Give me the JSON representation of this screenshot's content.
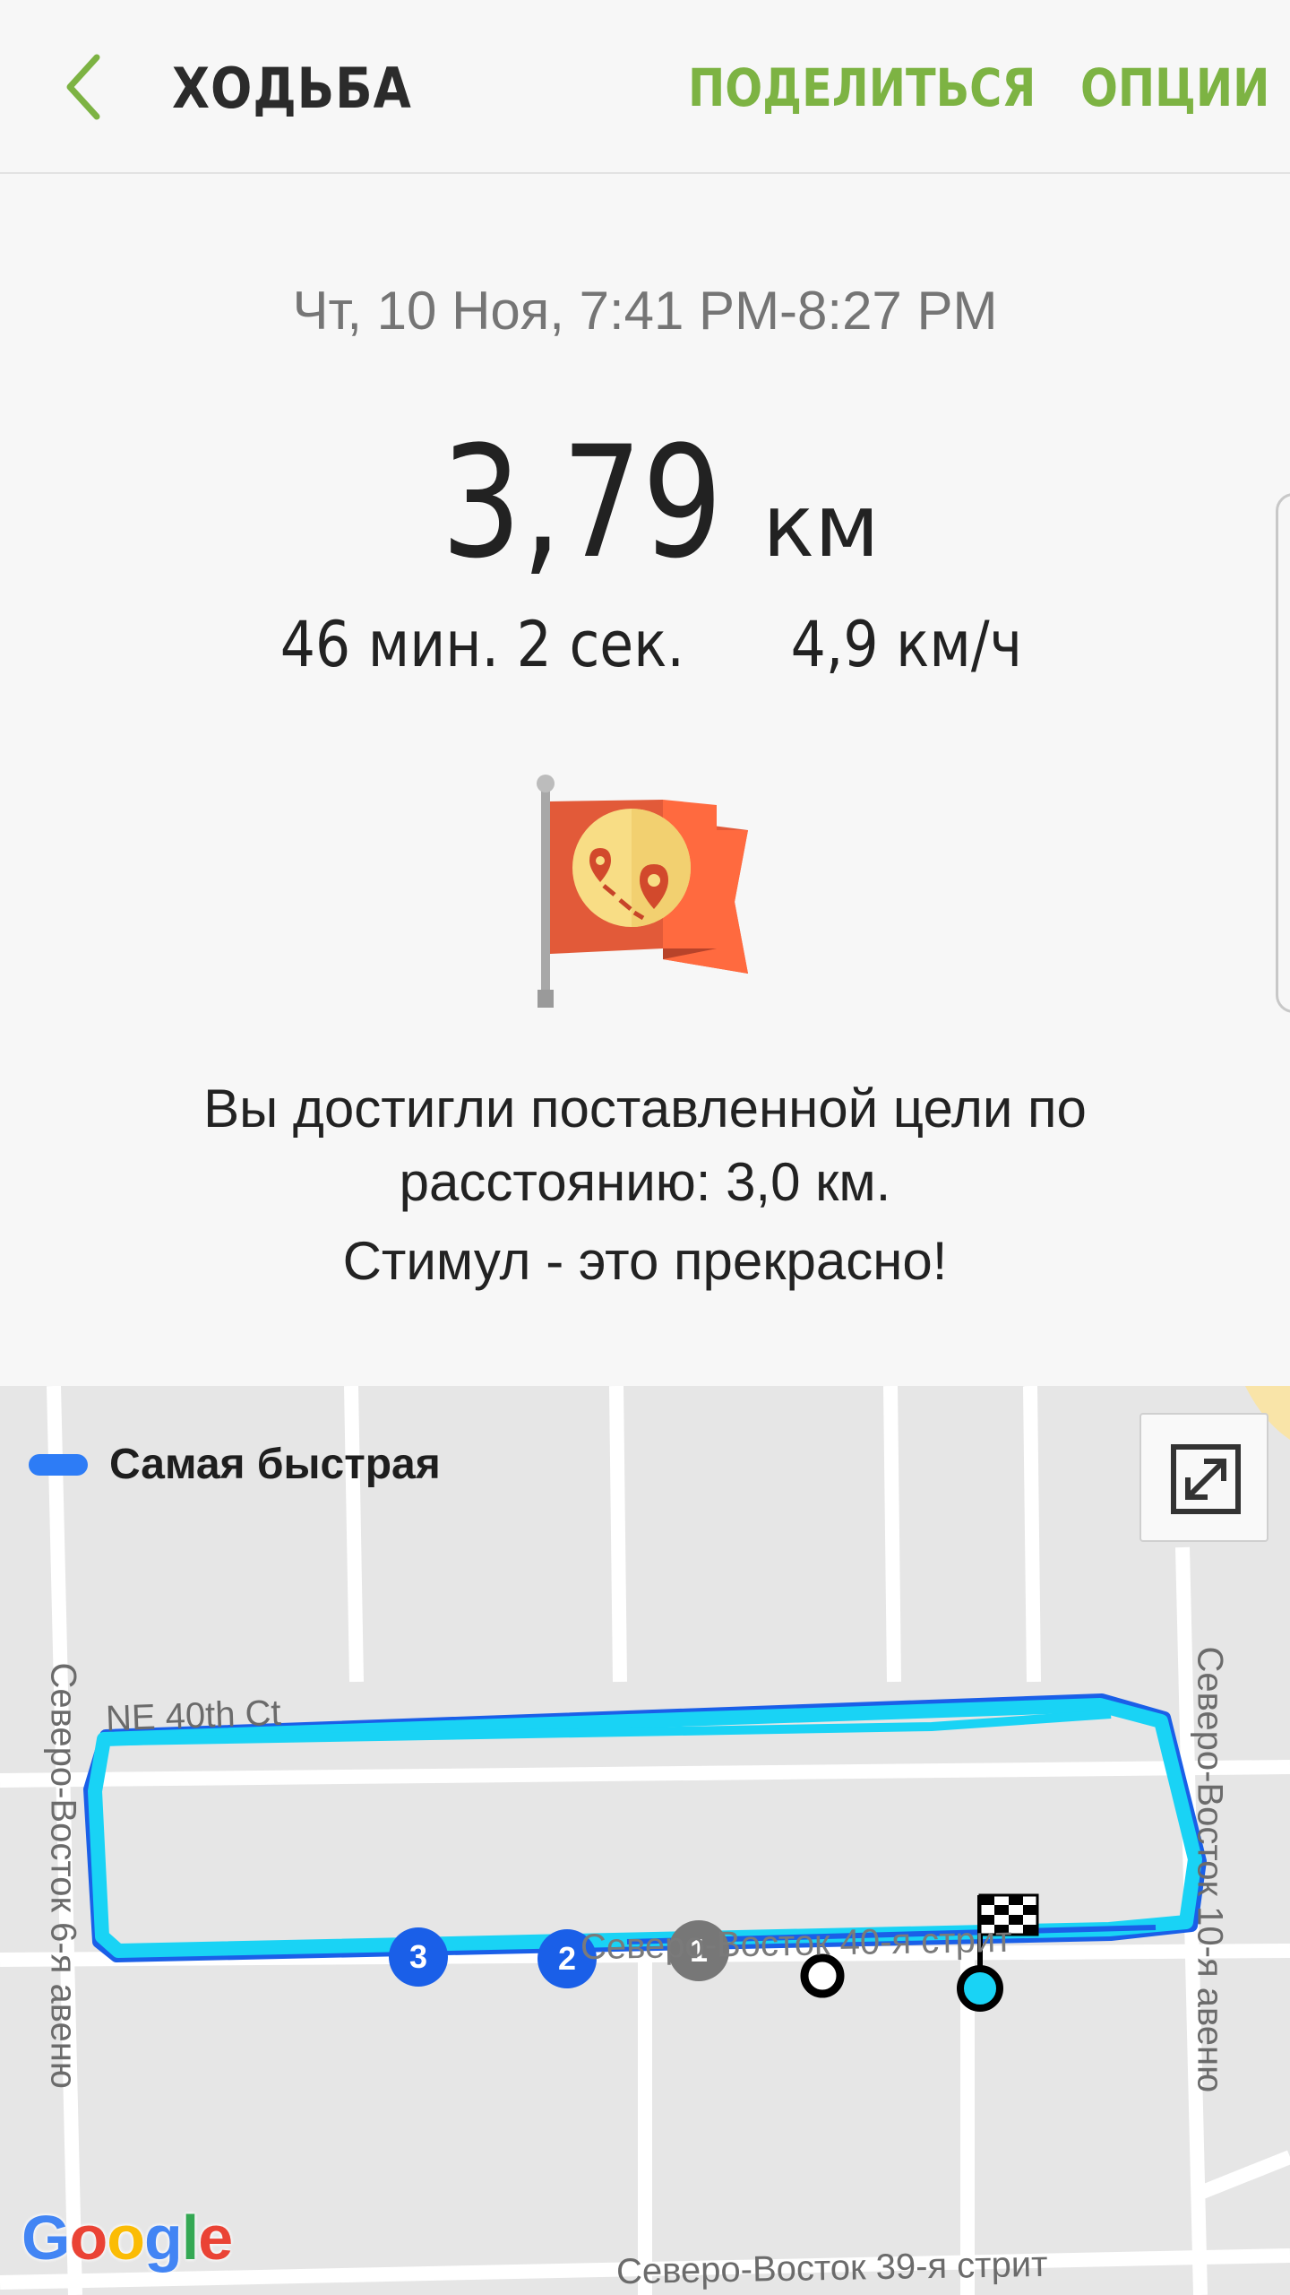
{
  "header": {
    "title": "ХОДЬБА",
    "share_label": "ПОДЕЛИТЬСЯ",
    "options_label": "ОПЦИИ"
  },
  "summary": {
    "date_range": "Чт, 10 Ноя, 7:41 PM-8:27 PM",
    "distance_value": "3,79",
    "distance_unit": "км",
    "duration": "46 мин. 2 сек.",
    "speed": "4,9 км/ч"
  },
  "goal": {
    "line1": "Вы достигли поставленной цели по",
    "line2": "расстоянию: 3,0 км.",
    "line3": "Стимул - это прекрасно!"
  },
  "map": {
    "legend_label": "Самая быстрая",
    "streets": {
      "ne40th": "NE 40th Ct",
      "ave6": "Северо-Восток 6-я авеню",
      "ave10": "Северо-Восток 10-я авеню",
      "st40": "Северо-Восток 40-я стрит",
      "st39": "Северо-Восток 39-я стрит"
    },
    "markers": [
      "3",
      "2",
      "1"
    ],
    "attribution": "Google"
  },
  "colors": {
    "accent_green": "#7db343",
    "route_cyan": "#19d3f5",
    "route_blue": "#1a5fe8",
    "marker_gray": "#777777",
    "legend_blue": "#2d7cf6"
  }
}
